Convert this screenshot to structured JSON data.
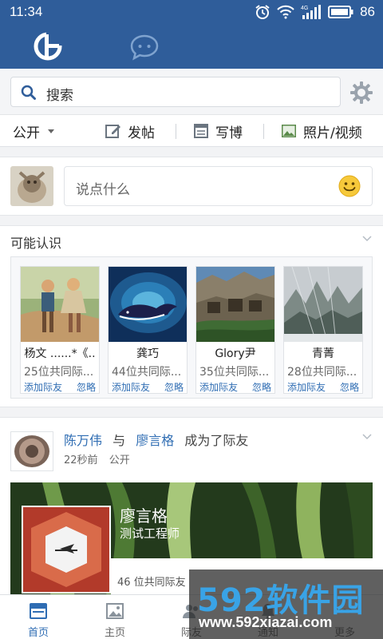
{
  "status_bar": {
    "time": "11:34",
    "network": "4G",
    "battery": "86"
  },
  "search": {
    "placeholder": "搜索"
  },
  "actions": {
    "visibility": "公开",
    "post": "发帖",
    "blog": "写博",
    "media": "照片/视频"
  },
  "composer": {
    "placeholder": "说点什么"
  },
  "pymk": {
    "title": "可能认识",
    "add_label": "添加际友",
    "ignore_label": "忽略",
    "people": [
      {
        "name": "杨文 ......*《..",
        "mutual": "25位共同际..."
      },
      {
        "name": "龚巧",
        "mutual": "44位共同际..."
      },
      {
        "name": "Glory尹",
        "mutual": "35位共同际..."
      },
      {
        "name": "青菁",
        "mutual": "28位共同际..."
      }
    ]
  },
  "feed": {
    "user": "陈万伟",
    "connector": "与",
    "friend": "廖言格",
    "action": "成为了际友",
    "time": "22秒前",
    "visibility": "公开",
    "card": {
      "name": "廖言格",
      "title": "测试工程师",
      "mutual": "46 位共同际友"
    }
  },
  "nav": [
    {
      "label": "首页",
      "icon": "home-icon",
      "active": true
    },
    {
      "label": "主页",
      "icon": "image-icon",
      "active": false
    },
    {
      "label": "际友",
      "icon": "friends-icon",
      "active": false
    },
    {
      "label": "通知",
      "icon": "bell-icon",
      "active": false
    },
    {
      "label": "更多",
      "icon": "more-icon",
      "active": false
    }
  ],
  "watermark": {
    "brand": "592软件园",
    "url": "www.592xiazai.com"
  },
  "colors": {
    "header": "#2f5d9a",
    "link": "#2f6db3"
  }
}
